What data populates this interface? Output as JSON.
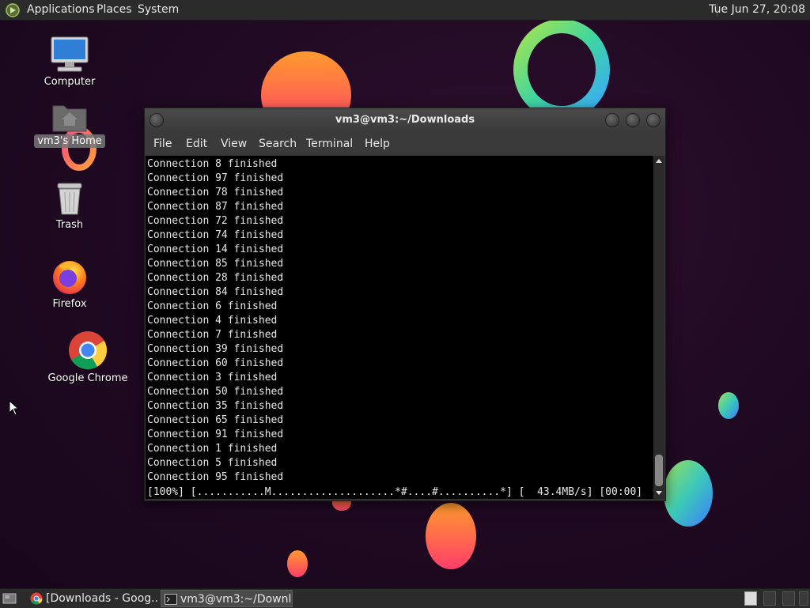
{
  "top_panel": {
    "menus": [
      "Applications",
      "Places",
      "System"
    ],
    "clock": "Tue Jun 27, 20:08"
  },
  "desktop_icons": [
    {
      "label": "Computer",
      "icon": "computer-icon"
    },
    {
      "label": "vm3's Home",
      "icon": "home-folder-icon",
      "selected": true
    },
    {
      "label": "Trash",
      "icon": "trash-icon"
    },
    {
      "label": "Firefox",
      "icon": "firefox-icon"
    },
    {
      "label": "Google Chrome",
      "icon": "chrome-icon"
    }
  ],
  "terminal": {
    "title": "vm3@vm3:~/Downloads",
    "menus": [
      "File",
      "Edit",
      "View",
      "Search",
      "Terminal",
      "Help"
    ],
    "lines": [
      "Connection 8 finished",
      "Connection 97 finished",
      "Connection 78 finished",
      "Connection 87 finished",
      "Connection 72 finished",
      "Connection 74 finished",
      "Connection 14 finished",
      "Connection 85 finished",
      "Connection 28 finished",
      "Connection 84 finished",
      "Connection 6 finished",
      "Connection 4 finished",
      "Connection 7 finished",
      "Connection 39 finished",
      "Connection 60 finished",
      "Connection 3 finished",
      "Connection 50 finished",
      "Connection 35 finished",
      "Connection 65 finished",
      "Connection 91 finished",
      "Connection 1 finished",
      "Connection 5 finished",
      "Connection 95 finished"
    ],
    "progress_line": "[100%] [...........M....................*#....#..........*] [  43.4MB/s] [00:00]"
  },
  "taskbar": {
    "tasks": [
      {
        "label": "[Downloads - Goog...",
        "icon": "chrome-icon",
        "active": false
      },
      {
        "label": "vm3@vm3:~/Downl...",
        "icon": "terminal-icon",
        "active": true
      }
    ]
  }
}
